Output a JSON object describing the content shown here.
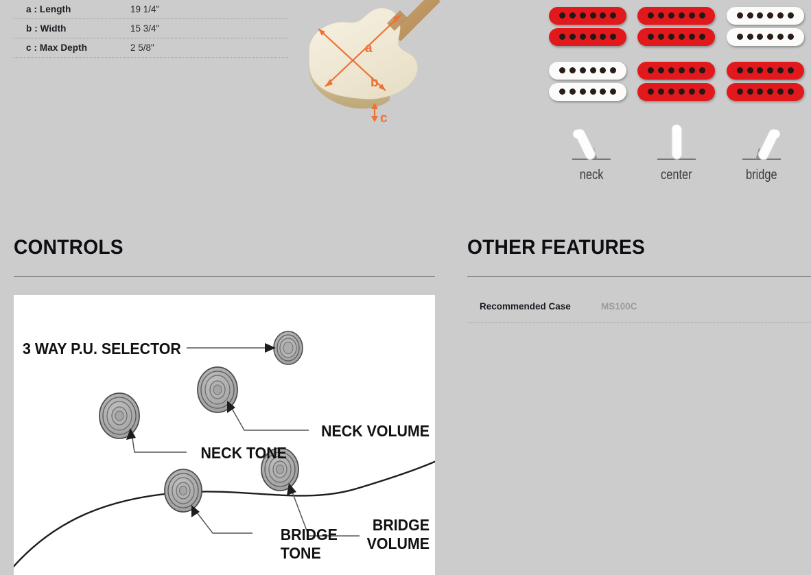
{
  "background_color": "#cccccc",
  "dimensions": {
    "rows": [
      {
        "label": "a : Length",
        "value": "19 1/4\""
      },
      {
        "label": "b : Width",
        "value": "15 3/4\""
      },
      {
        "label": "c : Max Depth",
        "value": "2 5/8\""
      }
    ]
  },
  "body_illustration": {
    "name": "guitar-body-3d-diagram",
    "callouts": [
      "a",
      "b",
      "c"
    ],
    "arrow_color": "#ee7136",
    "body_color": "#f3eddc",
    "side_color": "#cbb893",
    "neck_color": "#c19a6b"
  },
  "pickups": {
    "name": "pickup-configuration-grid",
    "red_color": "#e2191c",
    "white_color": "#fbfbfa",
    "pole_color": "#231815",
    "pole_count_per_coil": 6,
    "items": [
      {
        "id": "pickup-1",
        "color": "red"
      },
      {
        "id": "pickup-2",
        "color": "red"
      },
      {
        "id": "pickup-3",
        "color": "white"
      },
      {
        "id": "pickup-4",
        "color": "white"
      },
      {
        "id": "pickup-5",
        "color": "red"
      },
      {
        "id": "pickup-6",
        "color": "red"
      }
    ]
  },
  "switch_positions": {
    "name": "pickup-selector-positions",
    "items": [
      {
        "label": "neck",
        "angle": -28
      },
      {
        "label": "center",
        "angle": 0
      },
      {
        "label": "bridge",
        "angle": 28
      }
    ]
  },
  "controls": {
    "heading": "CONTROLS",
    "diagram": {
      "name": "controls-layout-diagram",
      "labels": [
        {
          "id": "selector",
          "text": "3 WAY P.U. SELECTOR"
        },
        {
          "id": "neck-volume",
          "text": "NECK VOLUME"
        },
        {
          "id": "neck-tone",
          "text": "NECK TONE"
        },
        {
          "id": "bridge-volume",
          "text": "BRIDGE VOLUME"
        },
        {
          "id": "bridge-tone",
          "text": "BRIDGE TONE"
        }
      ],
      "knob_color": "#a8a8a8",
      "line_color": "#555555",
      "background": "#ffffff"
    }
  },
  "other_features": {
    "heading": "OTHER FEATURES",
    "rows": [
      {
        "label": "Recommended Case",
        "value": "MS100C"
      }
    ]
  }
}
